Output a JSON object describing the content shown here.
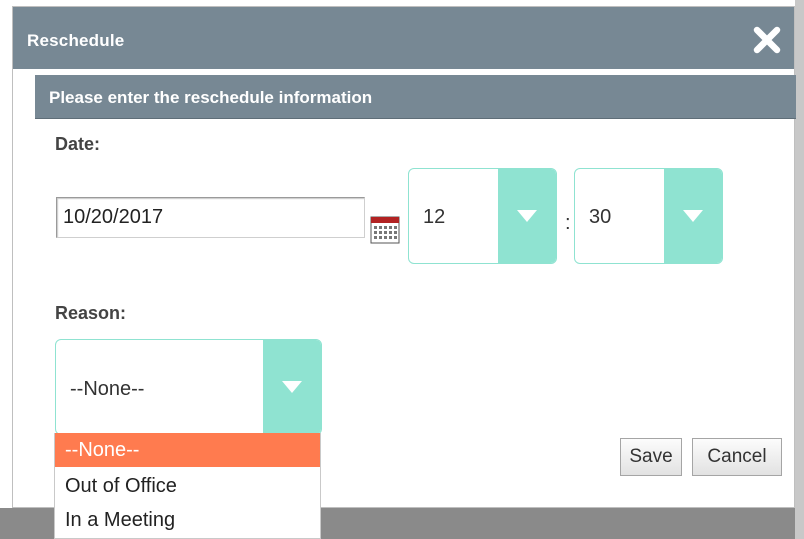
{
  "dialog": {
    "title": "Reschedule",
    "subtitle": "Please enter the reschedule information"
  },
  "form": {
    "date_label": "Date:",
    "date_value": "10/20/2017",
    "hour_value": "12",
    "time_separator": ":",
    "minute_value": "30",
    "reason_label": "Reason:",
    "reason_value": "--None--",
    "reason_options": [
      "--None--",
      "Out of Office",
      "In a Meeting"
    ]
  },
  "buttons": {
    "save": "Save",
    "cancel": "Cancel"
  },
  "icons": {
    "close": "close-icon",
    "calendar": "calendar-icon",
    "dropdown": "chevron-down-icon"
  },
  "colors": {
    "header": "#778894",
    "select_accent": "#8fe3d1",
    "option_highlight": "#ff7b4f"
  }
}
